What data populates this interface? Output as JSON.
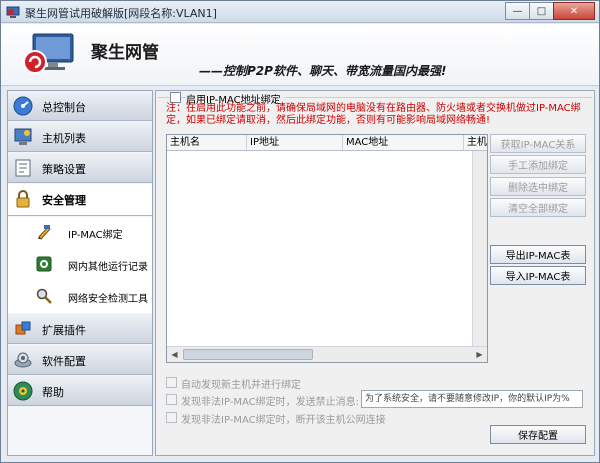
{
  "window": {
    "title": "聚生网管试用破解版[网段名称:VLAN1]",
    "min_symbol": "—",
    "max_symbol": "□",
    "close_symbol": "✕"
  },
  "banner": {
    "brand_name": "聚生网管",
    "slogan": "——控制P2P软件、聊天、带宽流量国内最强!"
  },
  "sidebar": {
    "items": [
      {
        "label": "总控制台",
        "icon": "dashboard-icon"
      },
      {
        "label": "主机列表",
        "icon": "host-list-icon"
      },
      {
        "label": "策略设置",
        "icon": "policy-icon"
      },
      {
        "label": "安全管理",
        "icon": "lock-icon"
      },
      {
        "label": "扩展插件",
        "icon": "plugin-icon"
      },
      {
        "label": "软件配置",
        "icon": "config-icon"
      },
      {
        "label": "帮助",
        "icon": "help-icon"
      }
    ],
    "sub_items": [
      {
        "label": "IP-MAC绑定",
        "icon": "pen-icon"
      },
      {
        "label": "网内其他运行记录",
        "icon": "record-icon"
      },
      {
        "label": "网络安全检测工具",
        "icon": "magnifier-icon"
      }
    ]
  },
  "main": {
    "enable_label": "启用IP-MAC地址绑定",
    "note": "注：在启用此功能之前，请确保局域网的电脑没有在路由器、防火墙或者交换机做过IP-MAC绑定，如果已绑定请取消，然后此绑定功能，否则有可能影响局域网络畅通!",
    "table_headers": [
      "主机名",
      "IP地址",
      "MAC地址",
      "主机"
    ],
    "buttons": {
      "get_ip_mac": "获取IP-MAC关系",
      "manual_bind": "手工添加绑定",
      "delete_selected": "删除选中绑定",
      "clear_all": "清空全部绑定",
      "export": "导出IP-MAC表",
      "import": "导入IP-MAC表",
      "save": "保存配置"
    },
    "option_auto_discover": "自动发现新主机并进行绑定",
    "option_send_msg": "发现非法IP-MAC绑定时，发送禁止消息:",
    "message_value": "为了系统安全，请不要随意修改IP，你的默认IP为%",
    "option_disconnect": "发现非法IP-MAC绑定时，断开该主机公网连接"
  },
  "colors": {
    "note_text": "#cc0000",
    "brand_red": "#d0202a"
  }
}
